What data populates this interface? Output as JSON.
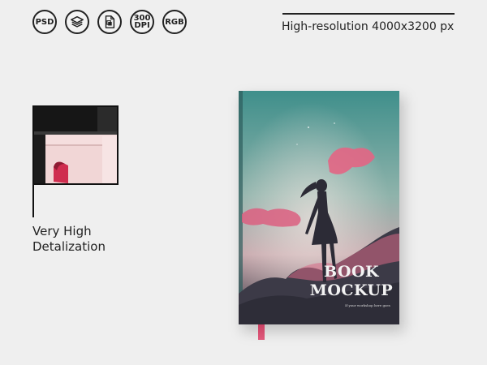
{
  "badges": [
    {
      "label": "PSD",
      "icon": "psd-label"
    },
    {
      "label": "",
      "icon": "layers-icon"
    },
    {
      "label": "",
      "icon": "smart-object-file-icon"
    },
    {
      "label_top": "300",
      "label_bottom": "DPI",
      "icon": "dpi-label"
    },
    {
      "label": "RGB",
      "icon": "rgb-label"
    }
  ],
  "resolution_text": "High-resolution 4000x3200 px",
  "detail": {
    "line1": "Very High",
    "line2": "Detalization"
  },
  "book": {
    "title_line1": "BOOK",
    "title_line2": "MOCKUP",
    "subtitle": "If your workshop here goes",
    "colors": {
      "sky_top": "#4f9a94",
      "sky_mid": "#9fb8b0",
      "horizon": "#c8a0a8",
      "cloud": "#e0607e",
      "silhouette": "#2b2a35",
      "ribbon": "#d14a6c"
    }
  }
}
